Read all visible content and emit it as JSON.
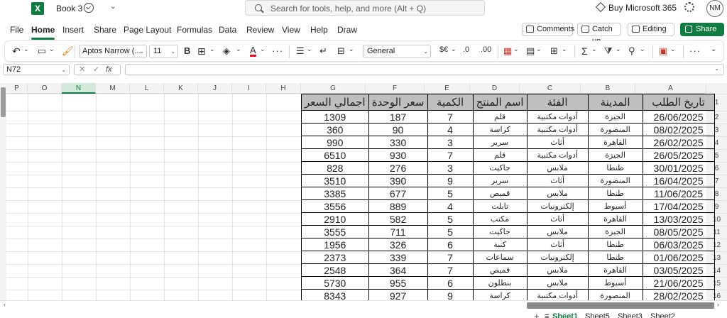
{
  "titlebar": {
    "app_logo": "X",
    "book_title": "Book 3",
    "search_placeholder": "Search for tools, help, and more (Alt + Q)",
    "buy_label": "Buy Microsoft 365",
    "avatar_initials": "NM"
  },
  "menu": [
    "File",
    "Home",
    "Insert",
    "Share",
    "Page Layout",
    "Formulas",
    "Data",
    "Review",
    "View",
    "Help",
    "Draw"
  ],
  "actions": {
    "comments": "Comments",
    "catch_up": "Catch up",
    "editing": "Editing",
    "share": "Share"
  },
  "ribbon": {
    "font_name": "Aptos Narrow (...",
    "font_size": "11",
    "bold": "B",
    "font_color_letter": "A",
    "more": "···",
    "number_format": "General",
    "currency": "$€",
    "dec_increase": ".0",
    "dec_decrease": ".00",
    "sum": "Σ"
  },
  "formula_bar": {
    "name_box": "N72",
    "fx": "fx",
    "formula": ""
  },
  "columns": [
    "P",
    "O",
    "N",
    "M",
    "L",
    "K",
    "J",
    "I",
    "H",
    "G",
    "F",
    "E",
    "D",
    "C",
    "B",
    "A"
  ],
  "selected_column": "N",
  "row_numbers": [
    "1",
    "2",
    "3",
    "4",
    "5",
    "6",
    "7",
    "8",
    "9",
    "10",
    "11",
    "12",
    "13",
    "14",
    "15",
    "16"
  ],
  "table": {
    "headers": {
      "total": "اجمالي السعر",
      "unit_price": "سعر الوحدة",
      "qty": "الكمية",
      "product": "اسم المنتج",
      "category": "الفئة",
      "city": "المدينة",
      "date": "تاريخ الطلب"
    },
    "rows": [
      {
        "total": "1309",
        "unit_price": "187",
        "qty": "7",
        "product": "قلم",
        "category": "أدوات مكتبية",
        "city": "الجيزة",
        "date": "26/06/2025"
      },
      {
        "total": "360",
        "unit_price": "90",
        "qty": "4",
        "product": "كراسة",
        "category": "أدوات مكتبية",
        "city": "المنصورة",
        "date": "08/02/2025"
      },
      {
        "total": "990",
        "unit_price": "330",
        "qty": "3",
        "product": "سرير",
        "category": "أثاث",
        "city": "القاهرة",
        "date": "26/02/2025"
      },
      {
        "total": "6510",
        "unit_price": "930",
        "qty": "7",
        "product": "قلم",
        "category": "أدوات مكتبية",
        "city": "الجيزة",
        "date": "26/05/2025"
      },
      {
        "total": "828",
        "unit_price": "276",
        "qty": "3",
        "product": "جاكيت",
        "category": "ملابس",
        "city": "طنطا",
        "date": "30/01/2025"
      },
      {
        "total": "3510",
        "unit_price": "390",
        "qty": "9",
        "product": "سرير",
        "category": "أثاث",
        "city": "المنصورة",
        "date": "16/04/2025"
      },
      {
        "total": "3385",
        "unit_price": "677",
        "qty": "5",
        "product": "قميص",
        "category": "ملابس",
        "city": "طنطا",
        "date": "11/06/2025"
      },
      {
        "total": "3556",
        "unit_price": "889",
        "qty": "4",
        "product": "تابلت",
        "category": "إلكترونيات",
        "city": "أسيوط",
        "date": "17/04/2025"
      },
      {
        "total": "2910",
        "unit_price": "582",
        "qty": "5",
        "product": "مكتب",
        "category": "أثاث",
        "city": "القاهرة",
        "date": "13/03/2025"
      },
      {
        "total": "3555",
        "unit_price": "711",
        "qty": "5",
        "product": "جاكيت",
        "category": "ملابس",
        "city": "الجيزة",
        "date": "08/05/2025"
      },
      {
        "total": "1956",
        "unit_price": "326",
        "qty": "6",
        "product": "كنبة",
        "category": "أثاث",
        "city": "طنطا",
        "date": "06/03/2025"
      },
      {
        "total": "2373",
        "unit_price": "339",
        "qty": "7",
        "product": "سماعات",
        "category": "إلكترونيات",
        "city": "طنطا",
        "date": "01/06/2025"
      },
      {
        "total": "2548",
        "unit_price": "364",
        "qty": "7",
        "product": "قميص",
        "category": "ملابس",
        "city": "القاهرة",
        "date": "03/05/2025"
      },
      {
        "total": "5730",
        "unit_price": "955",
        "qty": "6",
        "product": "بنطلون",
        "category": "ملابس",
        "city": "أسيوط",
        "date": "21/06/2025"
      },
      {
        "total": "8343",
        "unit_price": "927",
        "qty": "9",
        "product": "كراسة",
        "category": "أدوات مكتبية",
        "city": "المنصورة",
        "date": "28/02/2025"
      }
    ]
  },
  "sheets": [
    "Sheet1",
    "Sheet5",
    "Sheet3",
    "Sheet2"
  ],
  "active_sheet": "Sheet1",
  "icons": {
    "logo": "excel-logo-icon",
    "search": "search-icon",
    "settings": "gear-icon",
    "premium": "diamond-icon"
  },
  "colors": {
    "accent": "#107c41",
    "header_fill": "#bfbfbf"
  }
}
